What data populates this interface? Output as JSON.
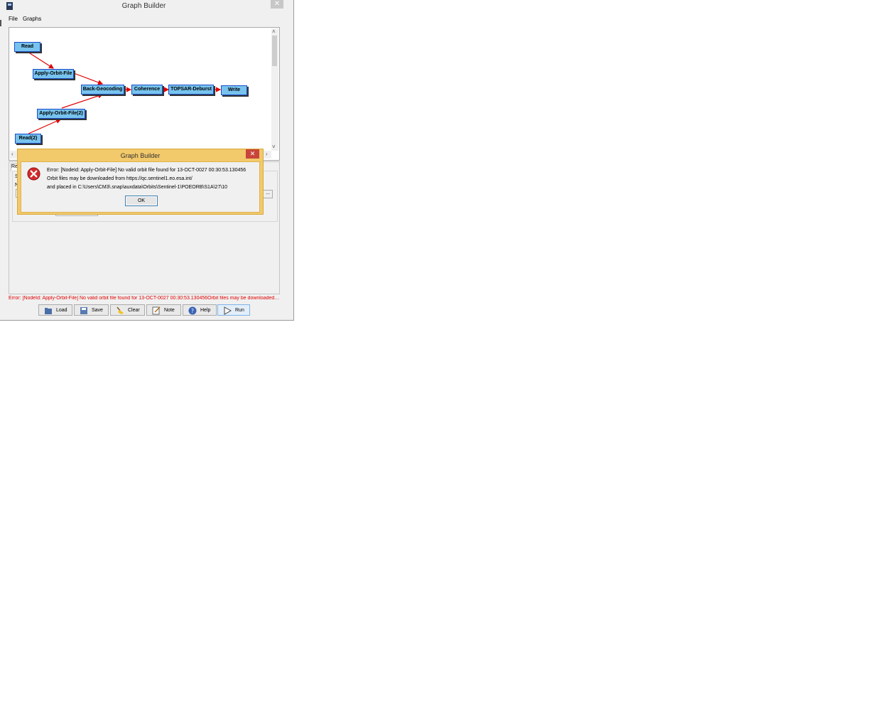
{
  "window": {
    "title": "Graph Builder",
    "close": "✕"
  },
  "menu": [
    {
      "label": "File"
    },
    {
      "label": "Graphs"
    }
  ],
  "graph": {
    "nodes": {
      "read": "Read",
      "apply_orbit": "Apply-Orbit-File",
      "back_geocoding": "Back-Geocoding",
      "coherence": "Coherence",
      "deburst": "TOPSAR-Deburst",
      "write": "Write",
      "apply_orbit_2": "Apply-Orbit-File(2)",
      "read_2": "Read(2)"
    },
    "edge_color": "#e00000",
    "node_color": "#77c3ee"
  },
  "lower_panel": {
    "tab_stub": "Re",
    "label_s": "S",
    "label_n": "N",
    "browse": "..."
  },
  "status_text": "Error: [NodeId: Apply-Orbit-File] No valid orbit file found for 13-OCT-0027 00:30:53.130456Orbit files may be downloaded fr...",
  "buttons": [
    {
      "label": "Load",
      "icon": "folder-icon"
    },
    {
      "label": "Save",
      "icon": "save-icon"
    },
    {
      "label": "Clear",
      "icon": "broom-icon"
    },
    {
      "label": "Note",
      "icon": "note-icon"
    },
    {
      "label": "Help",
      "icon": "help-icon"
    },
    {
      "label": "Run",
      "icon": "play-icon"
    }
  ],
  "dialog": {
    "title": "Graph Builder",
    "close": "✕",
    "lines": [
      "Error: [NodeId: Apply-Orbit-File] No valid orbit file found for 13-OCT-0027 00:30:53.130456",
      "Orbit files may be downloaded from https://qc.sentinel1.eo.esa.int/",
      "and placed in C:\\Users\\CM3\\.snap\\auxdata\\Orbits\\Sentinel-1\\POEORB\\S1A\\27\\10"
    ],
    "ok": "OK"
  }
}
